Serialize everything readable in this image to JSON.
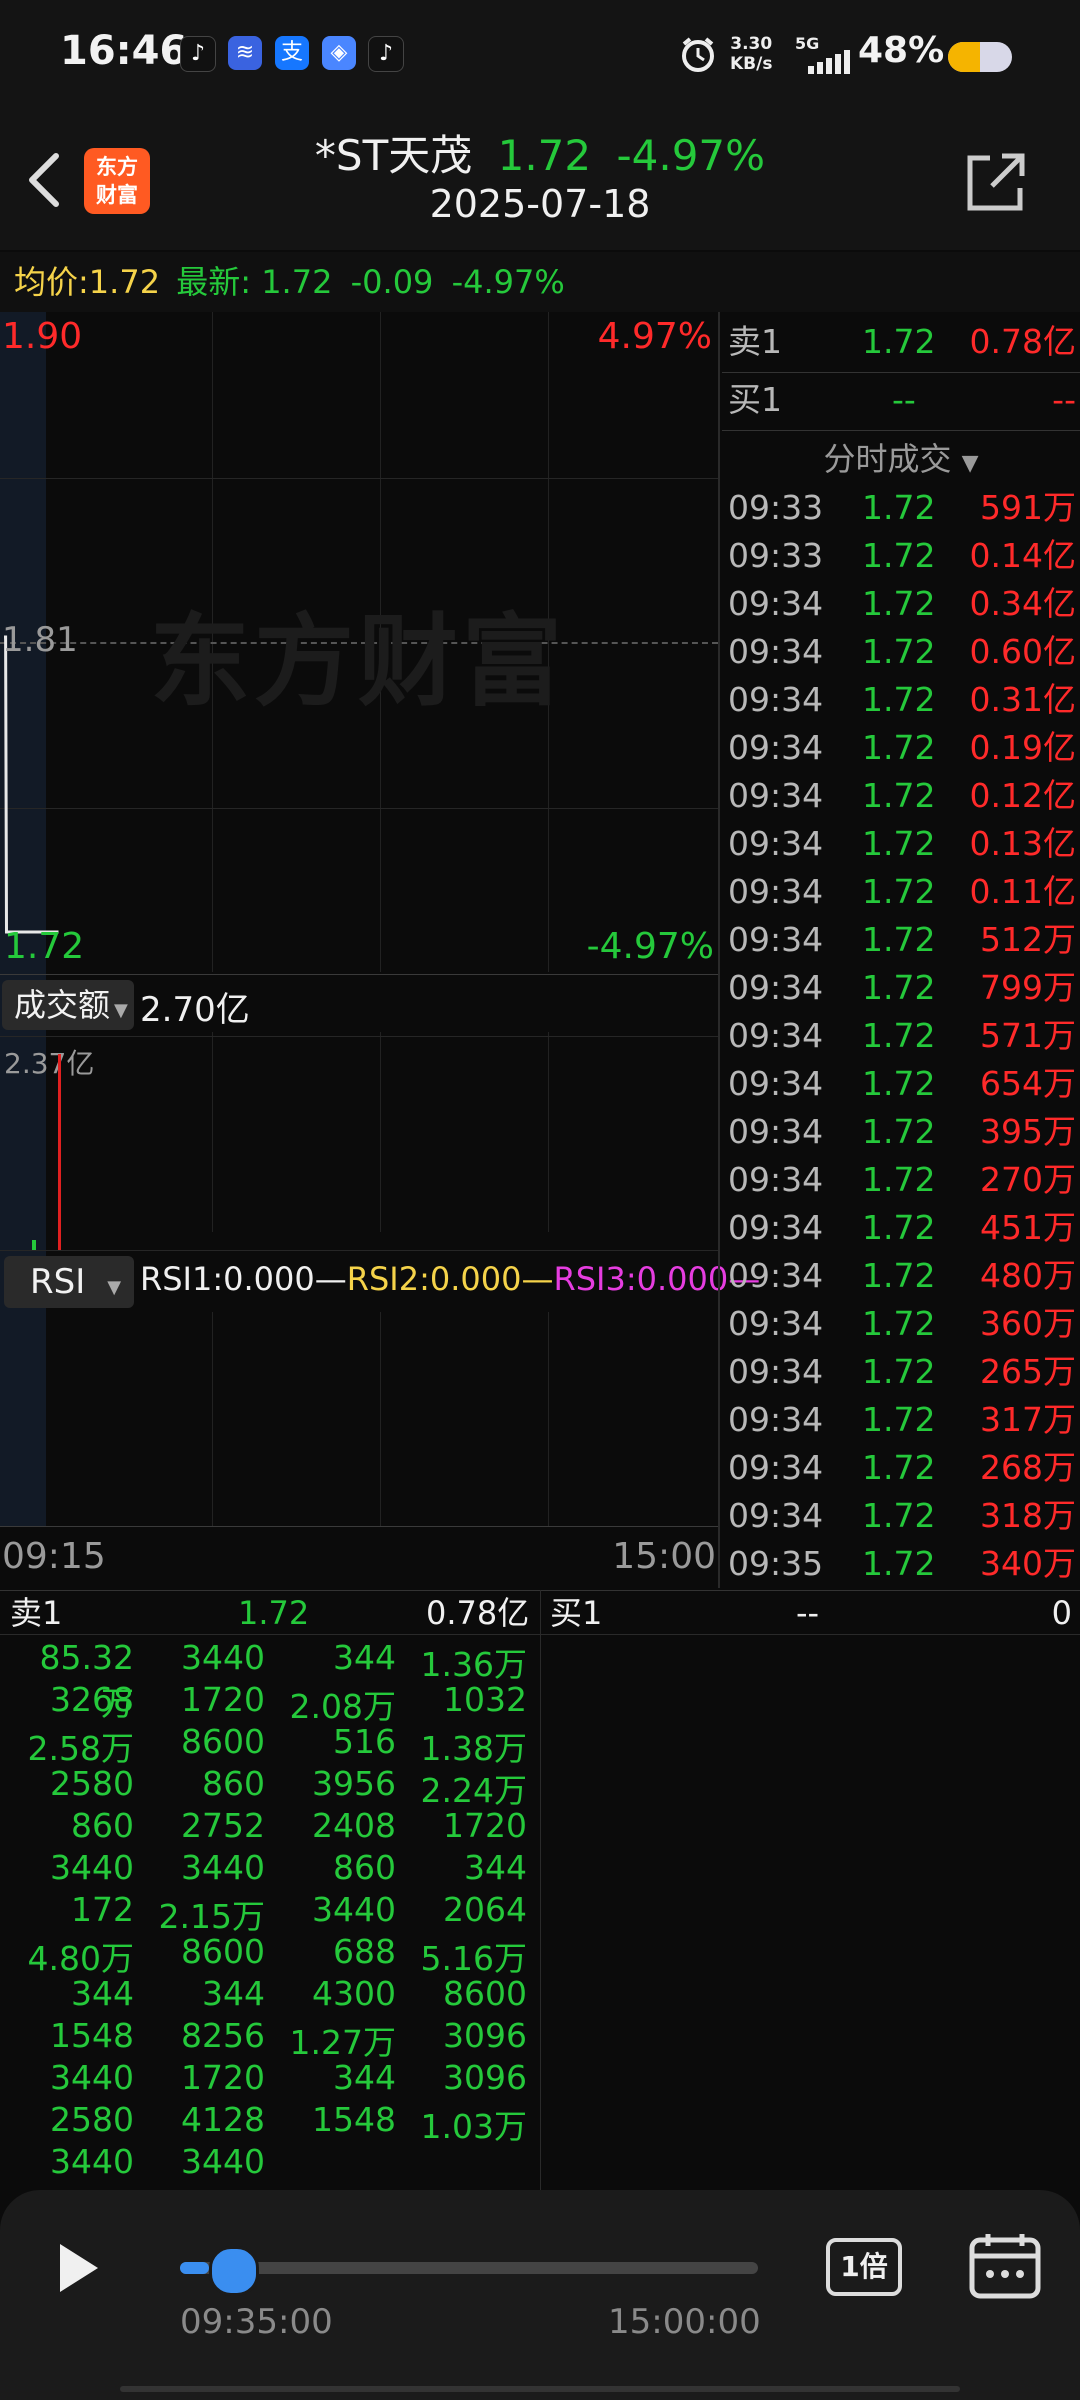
{
  "status_bar": {
    "time": "16:46",
    "net_speed_value": "3.30",
    "net_speed_unit": "KB/s",
    "net_type": "5G",
    "battery": "48%",
    "icons": [
      "tiktok-icon",
      "wifi-app-icon",
      "alipay-icon",
      "app-icon",
      "tiktok-icon",
      "alarm-icon",
      "signal-icon",
      "battery-icon"
    ]
  },
  "header": {
    "stock_name": "*ST天茂",
    "price": "1.72",
    "change_pct": "-4.97%",
    "date": "2025-07-18",
    "logo_line1": "东方",
    "logo_line2": "财富"
  },
  "info_bar": {
    "avg_label": "均价:",
    "avg_value": "1.72",
    "latest_label": "最新:",
    "latest_value": "1.72",
    "change": "-0.09",
    "change_pct": "-4.97%"
  },
  "price_chart": {
    "high_price": "1.90",
    "high_pct": "4.97%",
    "mid_price": "1.81",
    "low_price": "1.72",
    "low_pct": "-4.97%",
    "watermark": "东方财富",
    "volume_selector": "成交额",
    "volume_total": "2.70亿",
    "volume_max": "2.37亿",
    "rsi_selector": "RSI",
    "rsi1": "RSI1:0.000—",
    "rsi2": "RSI2:0.000—",
    "rsi3": "RSI3:0.000—",
    "time_start": "09:15",
    "time_end": "15:00"
  },
  "chart_data": {
    "type": "line",
    "x": [
      "09:15",
      "09:25",
      "09:30"
    ],
    "y": [
      1.81,
      1.81,
      1.72
    ],
    "ylim": [
      1.72,
      1.9
    ],
    "x_range": [
      "09:15",
      "15:00"
    ],
    "volume": {
      "x": [
        "09:25"
      ],
      "values": [
        2.37
      ],
      "unit": "亿"
    }
  },
  "order_book": {
    "sell1_label": "卖1",
    "sell1_price": "1.72",
    "sell1_amount": "0.78亿",
    "buy1_label": "买1",
    "buy1_price": "--",
    "buy1_amount": "--",
    "trade_header": "分时成交"
  },
  "trades": [
    {
      "time": "09:33",
      "price": "1.72",
      "vol": "591万"
    },
    {
      "time": "09:33",
      "price": "1.72",
      "vol": "0.14亿"
    },
    {
      "time": "09:34",
      "price": "1.72",
      "vol": "0.34亿"
    },
    {
      "time": "09:34",
      "price": "1.72",
      "vol": "0.60亿"
    },
    {
      "time": "09:34",
      "price": "1.72",
      "vol": "0.31亿"
    },
    {
      "time": "09:34",
      "price": "1.72",
      "vol": "0.19亿"
    },
    {
      "time": "09:34",
      "price": "1.72",
      "vol": "0.12亿"
    },
    {
      "time": "09:34",
      "price": "1.72",
      "vol": "0.13亿"
    },
    {
      "time": "09:34",
      "price": "1.72",
      "vol": "0.11亿"
    },
    {
      "time": "09:34",
      "price": "1.72",
      "vol": "512万"
    },
    {
      "time": "09:34",
      "price": "1.72",
      "vol": "799万"
    },
    {
      "time": "09:34",
      "price": "1.72",
      "vol": "571万"
    },
    {
      "time": "09:34",
      "price": "1.72",
      "vol": "654万"
    },
    {
      "time": "09:34",
      "price": "1.72",
      "vol": "395万"
    },
    {
      "time": "09:34",
      "price": "1.72",
      "vol": "270万"
    },
    {
      "time": "09:34",
      "price": "1.72",
      "vol": "451万"
    },
    {
      "time": "09:34",
      "price": "1.72",
      "vol": "480万"
    },
    {
      "time": "09:34",
      "price": "1.72",
      "vol": "360万"
    },
    {
      "time": "09:34",
      "price": "1.72",
      "vol": "265万"
    },
    {
      "time": "09:34",
      "price": "1.72",
      "vol": "317万"
    },
    {
      "time": "09:34",
      "price": "1.72",
      "vol": "268万"
    },
    {
      "time": "09:34",
      "price": "1.72",
      "vol": "318万"
    },
    {
      "time": "09:35",
      "price": "1.72",
      "vol": "340万"
    }
  ],
  "queue": {
    "sell_label": "卖1",
    "sell_price": "1.72",
    "sell_amount": "0.78亿",
    "buy_label": "买1",
    "buy_price": "--",
    "buy_amount": "0",
    "rows": [
      [
        "85.32万",
        "3440",
        "344",
        "1.36万"
      ],
      [
        "3268",
        "1720",
        "2.08万",
        "1032"
      ],
      [
        "2.58万",
        "8600",
        "516",
        "1.38万"
      ],
      [
        "2580",
        "860",
        "3956",
        "2.24万"
      ],
      [
        "860",
        "2752",
        "2408",
        "1720"
      ],
      [
        "3440",
        "3440",
        "860",
        "344"
      ],
      [
        "172",
        "2.15万",
        "3440",
        "2064"
      ],
      [
        "4.80万",
        "8600",
        "688",
        "5.16万"
      ],
      [
        "344",
        "344",
        "4300",
        "8600"
      ],
      [
        "1548",
        "8256",
        "1.27万",
        "3096"
      ],
      [
        "3440",
        "1720",
        "344",
        "3096"
      ],
      [
        "2580",
        "4128",
        "1548",
        "1.03万"
      ],
      [
        "3440",
        "3440",
        "",
        ""
      ]
    ]
  },
  "playback": {
    "current_time": "09:35:00",
    "end_time": "15:00:00",
    "speed": "1倍",
    "progress": 0.05
  }
}
